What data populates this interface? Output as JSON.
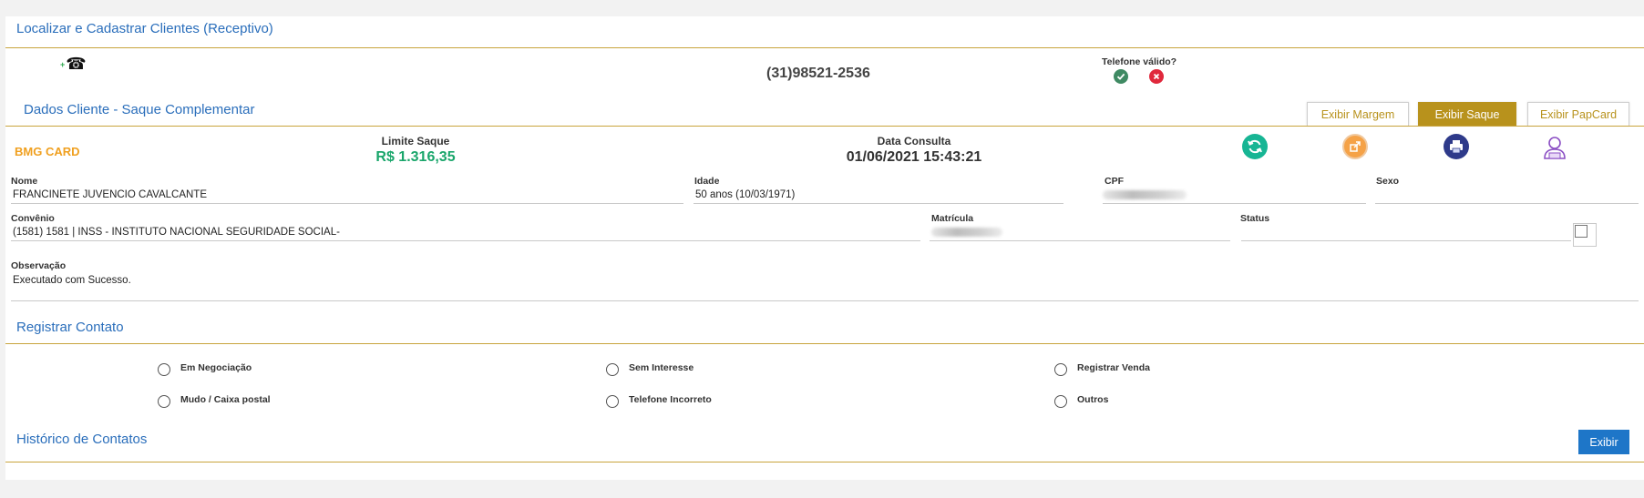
{
  "header": {
    "title": "Localizar e Cadastrar Clientes (Receptivo)"
  },
  "phone": {
    "number": "(31)98521-2536",
    "valid_label": "Telefone válido?"
  },
  "client_section": {
    "title": "Dados Cliente - Saque Complementar",
    "tabs": [
      {
        "label": "Exibir Margem",
        "active": false
      },
      {
        "label": "Exibir Saque",
        "active": true
      },
      {
        "label": "Exibir PapCard",
        "active": false
      }
    ]
  },
  "summary": {
    "product": "BMG CARD",
    "limit_label": "Limite Saque",
    "limit_value": "R$ 1.316,35",
    "date_label": "Data Consulta",
    "date_value": "01/06/2021 15:43:21"
  },
  "fields": {
    "nome_label": "Nome",
    "nome_value": "FRANCINETE JUVENCIO CAVALCANTE",
    "idade_label": "Idade",
    "idade_value": "50 anos (10/03/1971)",
    "cpf_label": "CPF",
    "sexo_label": "Sexo",
    "convenio_label": "Convênio",
    "convenio_value": "(1581) 1581 | INSS - INSTITUTO NACIONAL SEGURIDADE SOCIAL-",
    "matricula_label": "Matrícula",
    "status_label": "Status",
    "observacao_label": "Observação",
    "observacao_value": "Executado com Sucesso."
  },
  "contact_section": {
    "title": "Registrar Contato",
    "options": [
      "Em Negociação",
      "Sem Interesse",
      "Registrar Venda",
      "Mudo / Caixa postal",
      "Telefone Incorreto",
      "Outros"
    ]
  },
  "history_section": {
    "title": "Histórico de Contatos",
    "button_label": "Exibir"
  },
  "colors": {
    "accent_gold": "#b8921c",
    "link_blue": "#2a6ebb",
    "money_green": "#1aa66b",
    "product_orange": "#f0a020",
    "button_blue": "#1e76c8"
  }
}
